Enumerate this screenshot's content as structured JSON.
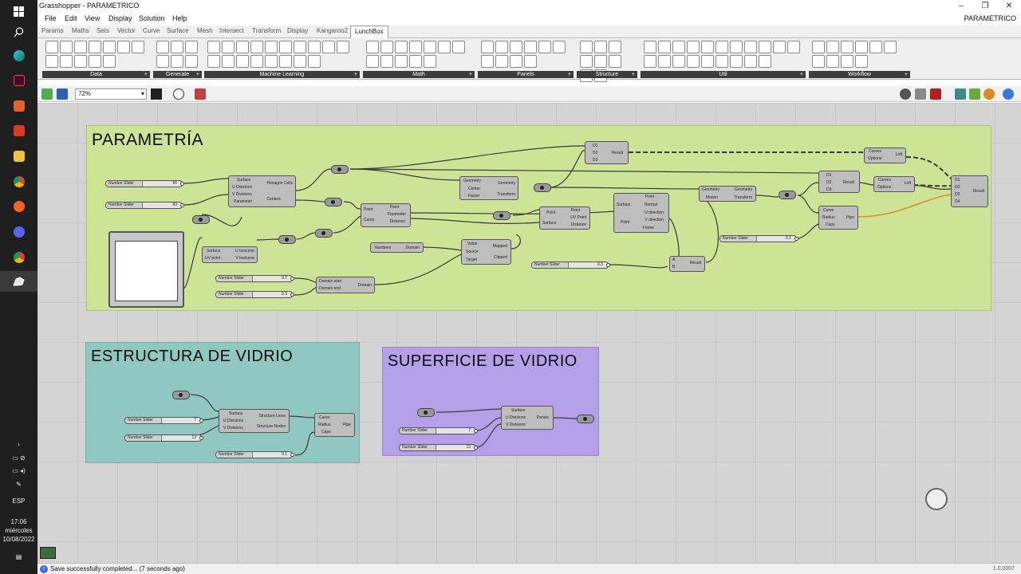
{
  "window": {
    "title": "Grasshopper - PARAMETRICO",
    "minimize": "‒",
    "maximize": "❐",
    "close": "✕"
  },
  "menu": {
    "items": [
      "File",
      "Edit",
      "View",
      "Display",
      "Solution",
      "Help"
    ],
    "document": "PARAMETRICO"
  },
  "tabs": [
    "Params",
    "Maths",
    "Sets",
    "Vector",
    "Curve",
    "Surface",
    "Mesh",
    "Intersect",
    "Transform",
    "Display",
    "Kangaroo2",
    "LunchBox"
  ],
  "active_tab": "LunchBox",
  "ribbon_groups": [
    {
      "label": "Data"
    },
    {
      "label": "Generate"
    },
    {
      "label": "Machine Learning"
    },
    {
      "label": "Math"
    },
    {
      "label": "Panels"
    },
    {
      "label": "Structure"
    },
    {
      "label": "Util"
    },
    {
      "label": "Workflow"
    }
  ],
  "canvas_toolbar": {
    "zoom": "72%"
  },
  "groups": {
    "parametria": "PARAMETRÍA",
    "estructura": "ESTRUCTURA DE VIDRIO",
    "superficie": "SUPERFICIE DE VIDRIO"
  },
  "components": {
    "hexagon": {
      "in": [
        "Surface",
        "U Divisions",
        "V Divisions",
        "Parameter"
      ],
      "out": [
        "Hexagon Cells",
        "Centers"
      ]
    },
    "scale": {
      "in": [
        "Geometry",
        "Center",
        "Factor"
      ],
      "out": [
        "Geometry",
        "Transform"
      ]
    },
    "curve_closest": {
      "in": [
        "Point",
        "Curve"
      ],
      "out": [
        "Point",
        "Parameter",
        "Distance"
      ]
    },
    "surface_closest": {
      "in": [
        "Point",
        "Surface"
      ],
      "out": [
        "Point",
        "UV Point",
        "Distance"
      ]
    },
    "eval_surface": {
      "in": [
        "Surface",
        "Point"
      ],
      "out": [
        "Point",
        "Normal",
        "U direction",
        "V direction",
        "Frame"
      ]
    },
    "move": {
      "in": [
        "Geometry",
        "Motion"
      ],
      "out": [
        "Geometry",
        "Transform"
      ]
    },
    "merge_top": {
      "in": [
        "D1",
        "D2",
        "D3"
      ],
      "out": [
        "Result"
      ]
    },
    "merge_mid": {
      "in": [
        "D1",
        "D2",
        "D3"
      ],
      "out": [
        "Result"
      ]
    },
    "merge_final": {
      "in": [
        "D1",
        "D2",
        "D3",
        "D4"
      ],
      "out": [
        "Result"
      ]
    },
    "loft_top": {
      "in": [
        "Curves",
        "Options"
      ],
      "out": [
        "Loft"
      ]
    },
    "loft_mid": {
      "in": [
        "Curves",
        "Options"
      ],
      "out": [
        "Loft"
      ]
    },
    "pipe": {
      "in": [
        "Curve",
        "Radius",
        "Caps"
      ],
      "out": [
        "Pipe"
      ]
    },
    "multiply": {
      "in": [
        "A",
        "B"
      ],
      "out": [
        "Result"
      ]
    },
    "remap": {
      "in": [
        "Value",
        "Source",
        "Target"
      ],
      "out": [
        "Mapped",
        "Clipped"
      ]
    },
    "bounds": {
      "in": [
        "Numbers"
      ],
      "out": [
        "Domain"
      ]
    },
    "construct_domain": {
      "in": [
        "Domain start",
        "Domain end"
      ],
      "out": [
        "Domain"
      ]
    },
    "isotrim": {
      "in": [
        "Surface",
        "UV point"
      ],
      "out": [
        "U Isocurve",
        "V Isocurve"
      ]
    },
    "structure": {
      "in": [
        "Surface",
        "U Divisions",
        "V Divisions"
      ],
      "out": [
        "Structure Lines",
        "Structure Nodes"
      ]
    },
    "pipe2": {
      "in": [
        "Curve",
        "Radius",
        "Caps"
      ],
      "out": [
        "Pipe"
      ]
    },
    "panels": {
      "in": [
        "Surface",
        "U Divisions",
        "V Divisions"
      ],
      "out": [
        "Panels"
      ]
    }
  },
  "sliders": {
    "s1": {
      "name": "Number Slider",
      "value": "66"
    },
    "s2": {
      "name": "Number Slider",
      "value": "83"
    },
    "s3": {
      "name": "Number Slider",
      "value": "0.7"
    },
    "s4": {
      "name": "Number Slider",
      "value": "0.3"
    },
    "s5": {
      "name": "Number Slider",
      "value": "0.3"
    },
    "s6": {
      "name": "Number Slider",
      "value": "0.1"
    },
    "s7": {
      "name": "Number Slider",
      "value": "7"
    },
    "s8": {
      "name": "Number Slider",
      "value": "13"
    },
    "s9": {
      "name": "Number Slider",
      "value": "0.1"
    },
    "s10": {
      "name": "Number Slider",
      "value": "7"
    },
    "s11": {
      "name": "Number Slider",
      "value": "13"
    }
  },
  "taskbar": {
    "lang": "ESP",
    "time": "17:06",
    "day": "miércoles",
    "date": "10/08/2022"
  },
  "status": {
    "message": "Save successfully completed... (7 seconds ago)",
    "version": "1.0.0007"
  }
}
